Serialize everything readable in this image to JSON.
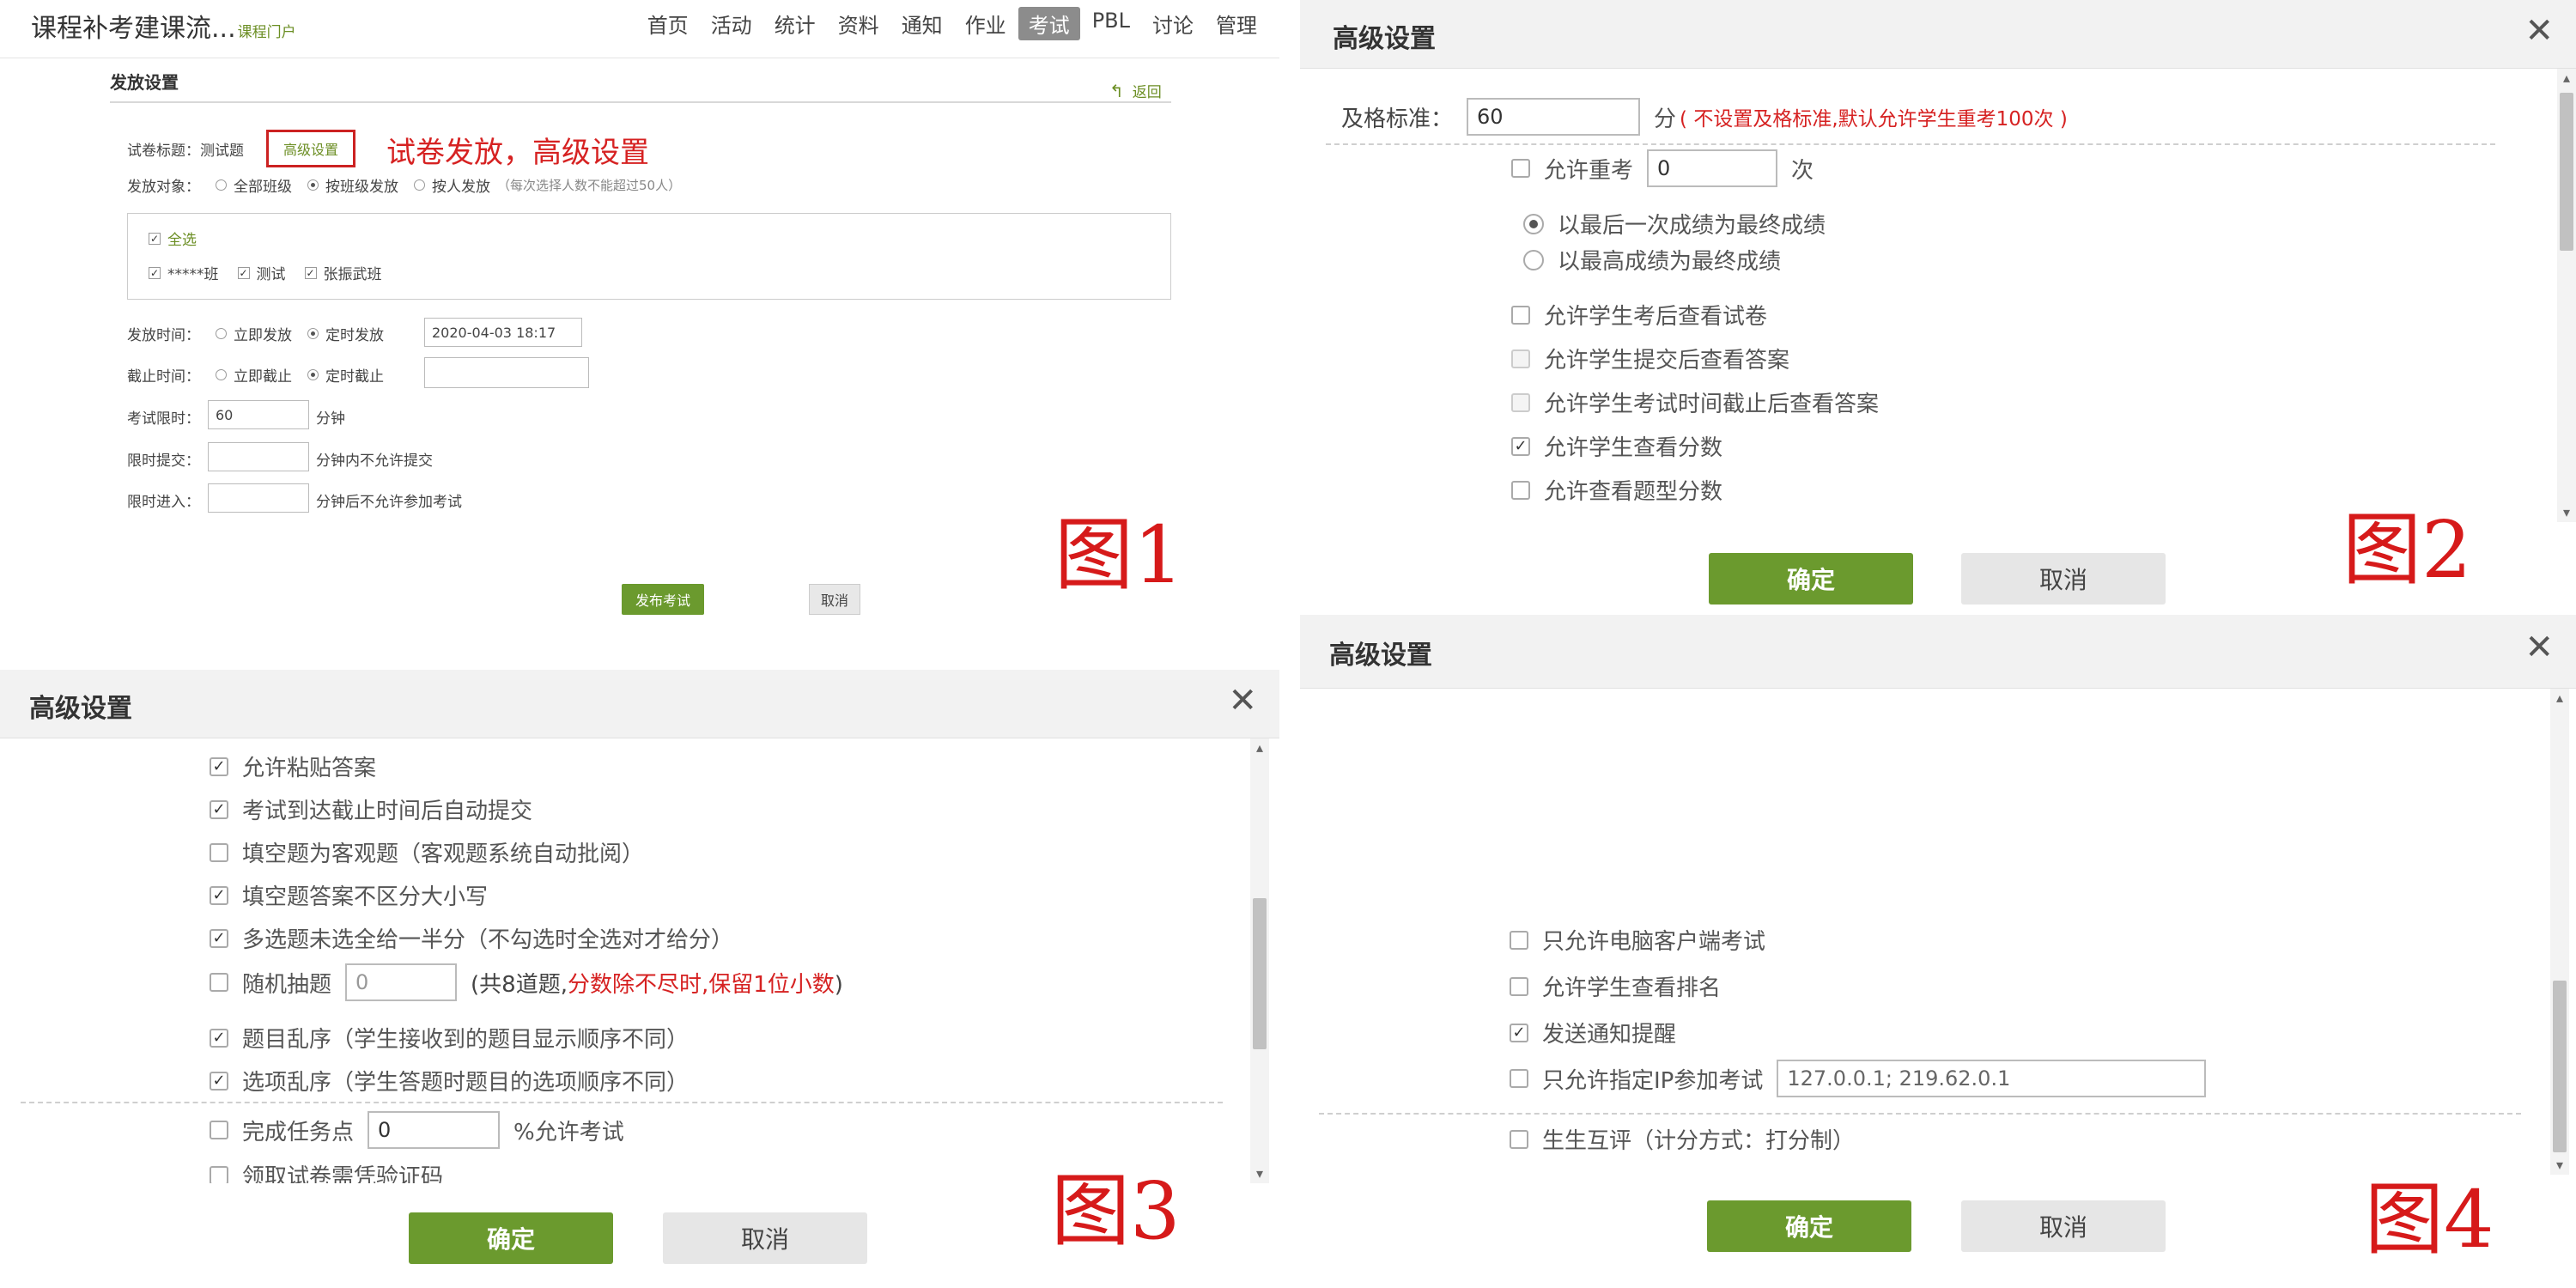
{
  "fig1": {
    "app_title": "课程补考建课流...",
    "app_sub": "课程门户",
    "nav": [
      "首页",
      "活动",
      "统计",
      "资料",
      "通知",
      "作业",
      "考试",
      "PBL",
      "讨论",
      "管理"
    ],
    "nav_active": "考试",
    "section_title": "发放设置",
    "back_label": "返回",
    "paper_title_label": "试卷标题：",
    "paper_title_value": "测试题",
    "advanced_link": "高级设置",
    "annotation": "试卷发放，高级设置",
    "target_label": "发放对象：",
    "target_options": [
      "全部班级",
      "按班级发放",
      "按人发放"
    ],
    "target_hint": "（每次选择人数不能超过50人）",
    "select_all": "全选",
    "classes": [
      "*****班",
      "测试",
      "张振武班"
    ],
    "send_time_label": "发放时间：",
    "send_time_options": [
      "立即发放",
      "定时发放"
    ],
    "send_time_value": "2020-04-03 18:17",
    "deadline_label": "截止时间：",
    "deadline_options": [
      "立即截止",
      "定时截止"
    ],
    "duration_label": "考试限时：",
    "duration_value": "60",
    "duration_unit": "分钟",
    "limit_submit_label": "限时提交：",
    "limit_submit_unit": "分钟内不允许提交",
    "limit_enter_label": "限时进入：",
    "limit_enter_unit": "分钟后不允许参加考试",
    "publish_button": "发布考试",
    "cancel_button": "取消",
    "figure_label": "图1"
  },
  "fig2": {
    "title": "高级设置",
    "pass_label": "及格标准：",
    "pass_value": "60",
    "pass_unit": "分",
    "pass_note": "( 不设置及格标准,默认允许学生重考100次 )",
    "retake_label": "允许重考",
    "retake_value": "0",
    "retake_unit": "次",
    "radio_last": "以最后一次成绩为最终成绩",
    "radio_highest": "以最高成绩为最终成绩",
    "opt_view_paper": "允许学生考后查看试卷",
    "opt_view_answer_submit": "允许学生提交后查看答案",
    "opt_view_answer_deadline": "允许学生考试时间截止后查看答案",
    "opt_view_score": "允许学生查看分数",
    "opt_view_type_score": "允许查看题型分数",
    "ok_button": "确定",
    "cancel_button": "取消",
    "figure_label": "图2"
  },
  "fig3": {
    "title": "高级设置",
    "opt_paste": "允许粘贴答案",
    "opt_auto_submit": "考试到达截止时间后自动提交",
    "opt_blank_objective": "填空题为客观题（客观题系统自动批阅）",
    "opt_blank_case": "填空题答案不区分大小写",
    "opt_multi_half": "多选题未选全给一半分（不勾选时全选对才给分）",
    "opt_random_label": "随机抽题",
    "opt_random_value": "0",
    "opt_random_note_a": "(共8道题,",
    "opt_random_note_b": "分数除不尽时,保留1位小数",
    "opt_random_note_c": ")",
    "opt_shuffle_q": "题目乱序（学生接收到的题目显示顺序不同）",
    "opt_shuffle_opt": "选项乱序（学生答题时题目的选项顺序不同）",
    "opt_task_label": "完成任务点",
    "opt_task_value": "0",
    "opt_task_unit": "%允许考试",
    "opt_verify": "领取试卷需凭验证码",
    "ok_button": "确定",
    "cancel_button": "取消",
    "figure_label": "图3"
  },
  "fig4": {
    "title": "高级设置",
    "opt_pc_only": "只允许电脑客户端考试",
    "opt_ranking": "允许学生查看排名",
    "opt_notify": "发送通知提醒",
    "opt_ip_label": "只允许指定IP参加考试",
    "opt_ip_value": "127.0.0.1; 219.62.0.1",
    "opt_peer": "生生互评（计分方式：打分制）",
    "ok_button": "确定",
    "cancel_button": "取消",
    "figure_label": "图4"
  }
}
